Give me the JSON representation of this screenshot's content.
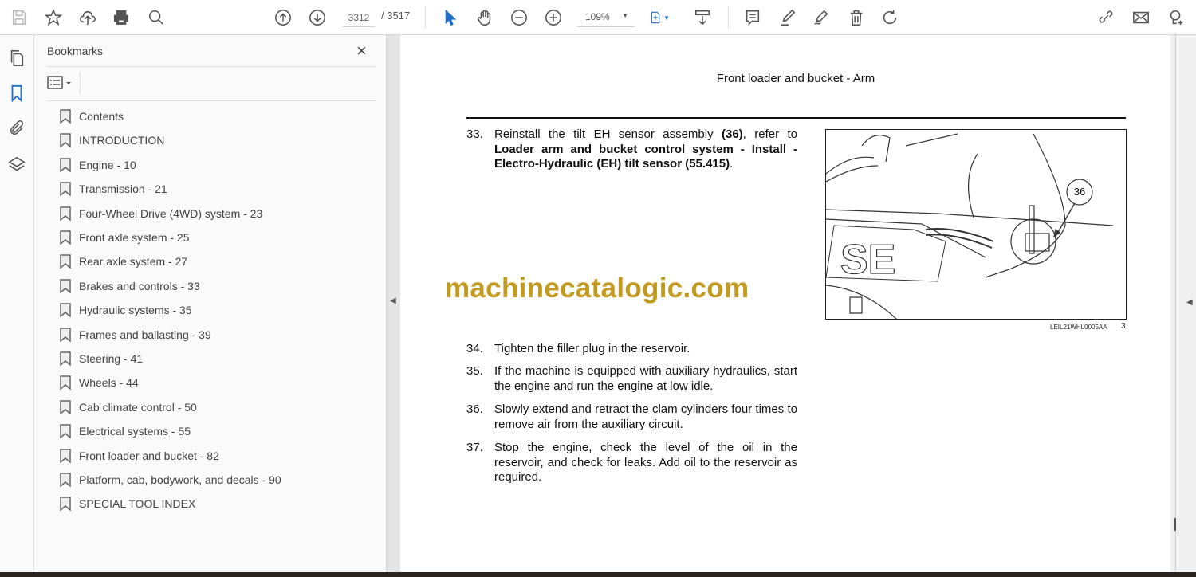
{
  "toolbar": {
    "page_current": "3312",
    "page_total": "/ 3517",
    "zoom": "109%"
  },
  "icons": [
    "save-icon",
    "bookmark-star-icon",
    "upload-cloud-icon",
    "print-icon",
    "search-zoom-icon",
    "page-up-icon",
    "page-down-icon",
    "select-cursor-icon",
    "hand-icon",
    "zoom-out-icon",
    "zoom-in-icon",
    "fit-page-icon",
    "scroll-mode-icon",
    "comment-icon",
    "highlight-icon",
    "sign-icon",
    "delete-icon",
    "rotate-icon",
    "share-link-icon",
    "mail-icon",
    "add-user-icon"
  ],
  "panel": {
    "title": "Bookmarks",
    "close": "×",
    "bookmarks": [
      "Contents",
      "INTRODUCTION",
      "Engine - 10",
      "Transmission - 21",
      "Four-Wheel Drive (4WD) system - 23",
      "Front axle system - 25",
      "Rear axle system - 27",
      "Brakes and controls - 33",
      "Hydraulic systems - 35",
      "Frames and ballasting - 39",
      "Steering - 41",
      "Wheels - 44",
      "Cab climate control - 50",
      "Electrical systems - 55",
      "Front loader and bucket - 82",
      "Platform, cab, bodywork, and decals - 90",
      "SPECIAL TOOL INDEX"
    ]
  },
  "document": {
    "header": "Front loader and bucket - Arm",
    "step33": {
      "num": "33.",
      "a": "Reinstall the tilt EH sensor assembly ",
      "b": "(36)",
      "c": ", refer to ",
      "d": "Loader arm and bucket control system - Install - Electro-Hydraulic (EH) tilt sensor (55.415)",
      "e": "."
    },
    "steps": [
      {
        "num": "34.",
        "text": "Tighten the filler plug in the reservoir."
      },
      {
        "num": "35.",
        "text": "If the machine is equipped with auxiliary hydraulics, start the engine and run the engine at low idle."
      },
      {
        "num": "36.",
        "text": "Slowly extend and retract the clam cylinders four times to remove air from the auxiliary circuit."
      },
      {
        "num": "37.",
        "text": "Stop the engine, check the level of the oil in the reservoir, and check for leaks.  Add oil to the reservoir as required."
      }
    ],
    "figure": {
      "callout": "36",
      "caption": "LEIL21WHL0005AA",
      "number": "3",
      "logo_text": "SE"
    },
    "watermark": "machinecatalogic.com"
  },
  "colors": {
    "accent": "#1f6fc5",
    "watermark": "#c49a1e"
  }
}
